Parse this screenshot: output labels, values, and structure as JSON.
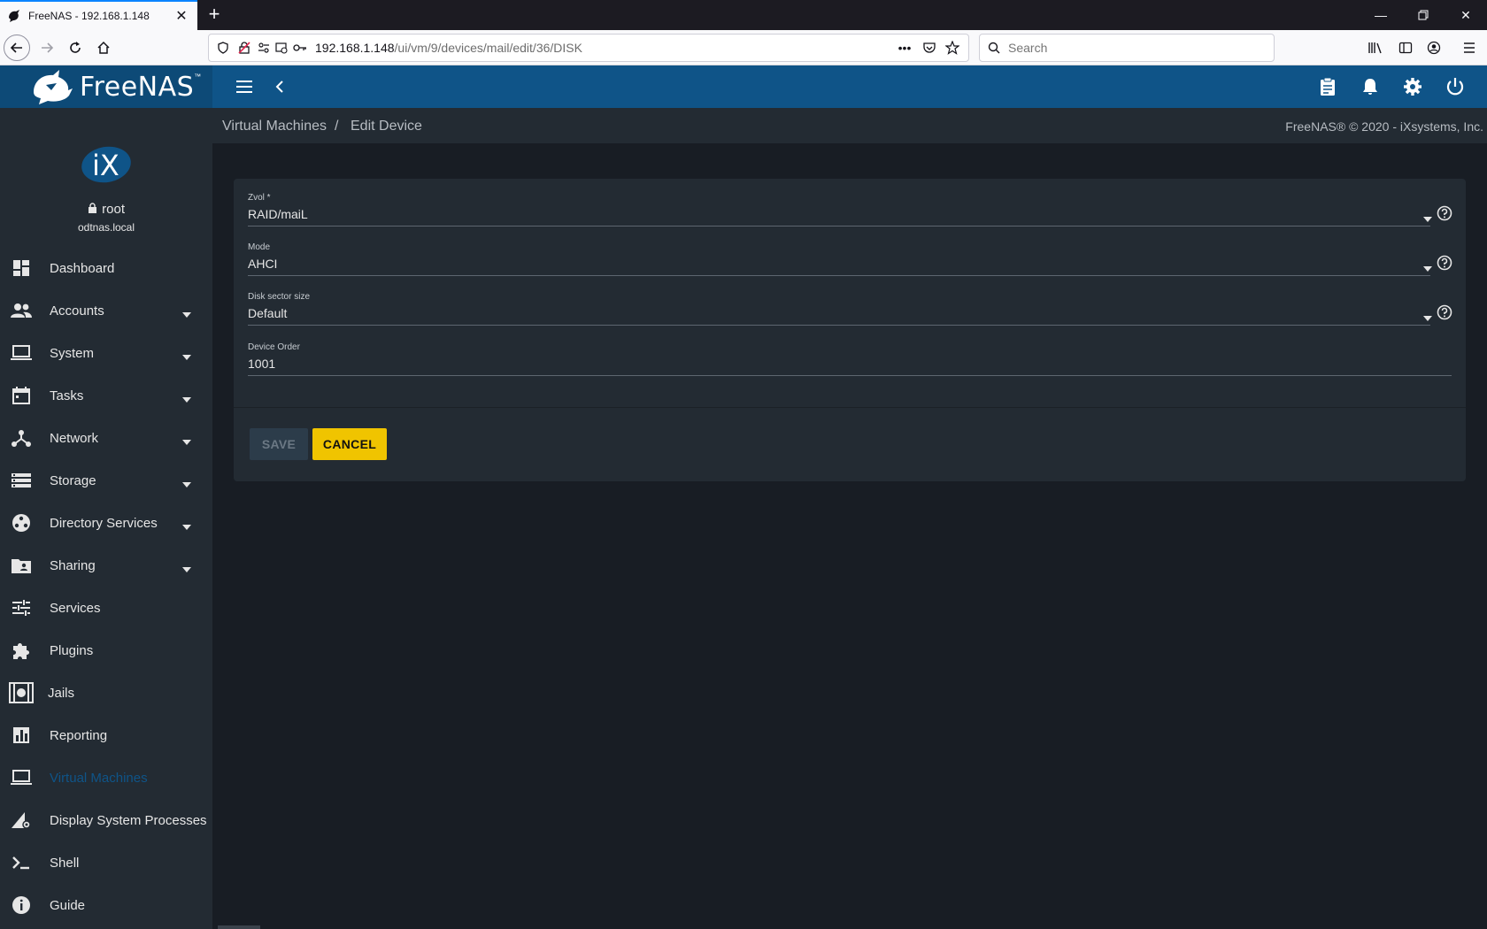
{
  "browser": {
    "tab_title": "FreeNAS - 192.168.1.148",
    "url_host": "192.168.1.148",
    "url_path": "/ui/vm/9/devices/mail/edit/36/DISK",
    "search_placeholder": "Search"
  },
  "app": {
    "brand": "FreeNAS",
    "brand_tm": "™"
  },
  "profile": {
    "user": "root",
    "host": "odtnas.local"
  },
  "sidebar": {
    "items": [
      {
        "label": "Dashboard"
      },
      {
        "label": "Accounts"
      },
      {
        "label": "System"
      },
      {
        "label": "Tasks"
      },
      {
        "label": "Network"
      },
      {
        "label": "Storage"
      },
      {
        "label": "Directory Services"
      },
      {
        "label": "Sharing"
      },
      {
        "label": "Services"
      },
      {
        "label": "Plugins"
      },
      {
        "label": "Jails"
      },
      {
        "label": "Reporting"
      },
      {
        "label": "Virtual Machines"
      },
      {
        "label": "Display System Processes"
      },
      {
        "label": "Shell"
      },
      {
        "label": "Guide"
      }
    ]
  },
  "breadcrumb": {
    "parent": "Virtual Machines",
    "separator": "/",
    "current": "Edit Device"
  },
  "copyright": "FreeNAS® © 2020 - iXsystems, Inc.",
  "form": {
    "zvol_label": "Zvol *",
    "zvol_value": "RAID/maiL",
    "mode_label": "Mode",
    "mode_value": "AHCI",
    "sector_label": "Disk sector size",
    "sector_value": "Default",
    "order_label": "Device Order",
    "order_value": "1001",
    "save_label": "SAVE",
    "cancel_label": "CANCEL"
  },
  "colors": {
    "accent": "#0f5488",
    "cancel": "#f0c400",
    "sidebar": "#232b33",
    "background": "#181d24"
  }
}
